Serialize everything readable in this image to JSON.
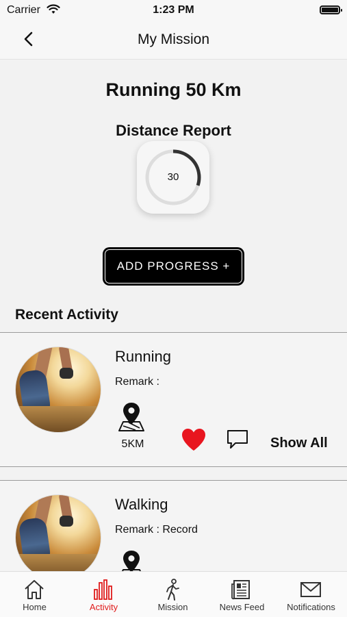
{
  "status_bar": {
    "carrier": "Carrier",
    "time": "1:23 PM"
  },
  "nav": {
    "title": "My Mission",
    "back_icon": "chevron-left-icon"
  },
  "mission": {
    "title": "Running 50 Km",
    "report_title": "Distance Report",
    "progress_value": "30",
    "progress_fraction": 0.3
  },
  "add_progress": {
    "label": "ADD PROGRESS +"
  },
  "recent": {
    "title": "Recent Activity",
    "items": [
      {
        "name": "Running",
        "remark": "Remark :",
        "distance": "5KM",
        "show_all": "Show All"
      },
      {
        "name": "Walking",
        "remark": "Remark : Record"
      }
    ]
  },
  "tabs": [
    {
      "label": "Home",
      "icon": "home-icon"
    },
    {
      "label": "Activity",
      "icon": "activity-chart-icon",
      "active": true
    },
    {
      "label": "Mission",
      "icon": "walking-person-icon"
    },
    {
      "label": "News Feed",
      "icon": "newspaper-icon"
    },
    {
      "label": "Notifications",
      "icon": "mail-icon"
    }
  ],
  "colors": {
    "accent": "#e01b1b",
    "heart": "#e8151f",
    "button_bg": "#000000",
    "ring": "#333333",
    "ring_track": "#dddddd"
  }
}
